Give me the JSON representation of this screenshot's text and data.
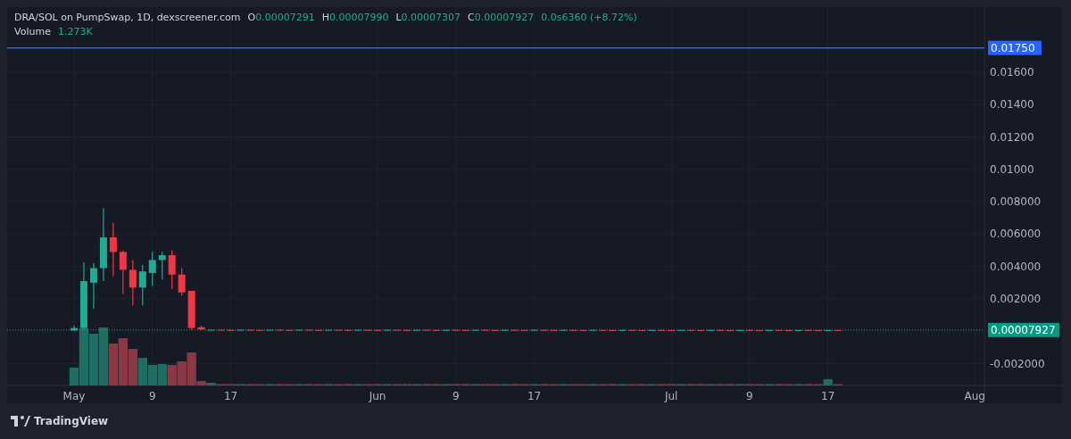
{
  "legend": {
    "title": "DRA/SOL on PumpSwap, 1D, dexscreener.com",
    "values": [
      {
        "label": "O",
        "value": "0.00007291"
      },
      {
        "label": "H",
        "value": "0.00007990"
      },
      {
        "label": "L",
        "value": "0.00007307"
      },
      {
        "label": "C",
        "value": "0.00007927"
      }
    ],
    "change": "0.0s6360 (+8.72%)",
    "volume_label": "Volume",
    "volume_value": "1.273K"
  },
  "price_axis": {
    "labels": [
      "0.01600",
      "0.01400",
      "0.01200",
      "0.01000",
      "0.008000",
      "0.006000",
      "0.004000",
      "0.002000",
      "-0.002000"
    ]
  },
  "time_axis": {
    "labels": [
      "May",
      "9",
      "17",
      "Jun",
      "9",
      "17",
      "Jul",
      "9",
      "17",
      "Aug"
    ]
  },
  "price_line_label": "0.01750",
  "last_price_label": "0.00007927",
  "footer": {
    "brand": "TradingView"
  }
}
